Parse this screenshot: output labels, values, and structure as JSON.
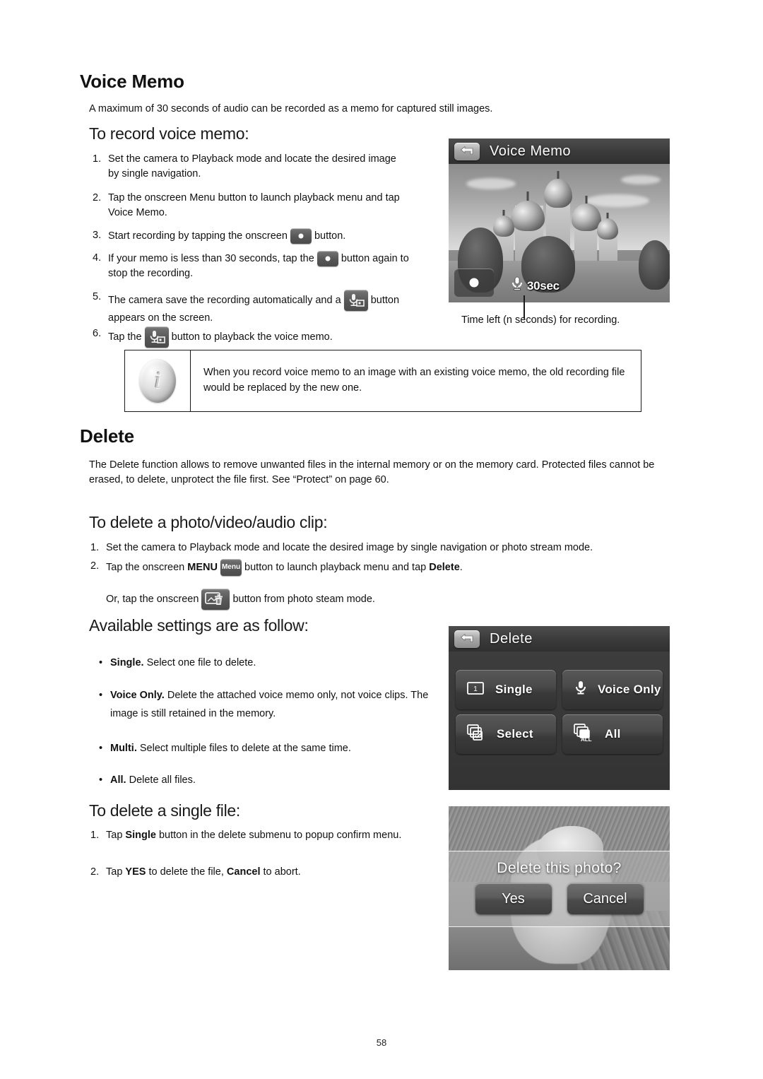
{
  "section_voice_memo": {
    "heading": "Voice Memo",
    "intro": "A maximum of 30 seconds of audio can be recorded as a memo for captured still images.",
    "subheading": "To record voice memo:",
    "steps": [
      {
        "n": "1.",
        "text": "Set the camera to Playback mode and locate the desired image by single navigation."
      },
      {
        "n": "2.",
        "text": "Tap the onscreen Menu button to launch playback menu and tap Voice Memo."
      },
      {
        "n": "3.",
        "pre": "Start recording by tapping the onscreen",
        "icon": "record-button-icon",
        "post": "button."
      },
      {
        "n": "4.",
        "pre": "If your memo is less than 30 seconds, tap the",
        "icon": "record-button-icon",
        "post": "button again to stop the recording."
      },
      {
        "n": "5.",
        "pre": "The camera save the recording automatically and a",
        "icon": "voice-memo-playback-icon",
        "post": "button appears on the screen."
      },
      {
        "n": "6.",
        "pre": "Tap the",
        "icon": "voice-memo-playback-icon",
        "post": "button to playback the voice memo."
      }
    ],
    "note": "When you record voice memo to an image with an existing voice memo, the old recording file would be replaced by the new one.",
    "caption": "Time left (n seconds) for recording."
  },
  "lcd_voice_memo": {
    "title": "Voice Memo",
    "back_icon": "back-arrow-icon",
    "record_icon": "record-dot-icon",
    "mic_icon": "microphone-icon",
    "time_left": "30sec"
  },
  "section_delete": {
    "heading": "Delete",
    "intro": "The Delete function allows to remove unwanted files in the internal memory or on the memory card. Protected files cannot be erased, to delete, unprotect the file first. See “Protect” on page 60.",
    "subheading_clip": "To delete a photo/video/audio clip:",
    "steps": [
      {
        "n": "1.",
        "text": "Set the camera to Playback mode and locate the desired image by single navigation or photo stream mode."
      }
    ],
    "step2_pre": "Tap the onscreen",
    "step2_menu_bold": "MENU",
    "step2_menu_icon_label": "Menu",
    "step2_post": "button to launch playback menu and tap",
    "step2_bold_end": "Delete",
    "step2_period": ".",
    "step2_or_pre": "Or, tap the onscreen",
    "step2_or_icon": "photo-trash-icon",
    "step2_or_post": "button from photo steam mode.",
    "subheading_settings": "Available settings are as follow:",
    "bullets": [
      {
        "bold": "Single.",
        "text": "Select one file to delete."
      },
      {
        "bold": "Voice Only.",
        "text": "Delete the attached voice memo only, not voice clips. The image is still retained in the memory."
      },
      {
        "bold": "Multi.",
        "text": "Select multiple files to delete at the same time."
      },
      {
        "bold": "All.",
        "text": "Delete all files."
      }
    ],
    "subheading_single": "To delete a single file:",
    "single_steps": [
      {
        "n": "1.",
        "pre": "Tap",
        "bold": "Single",
        "post": "button in the delete submenu to popup confirm menu."
      },
      {
        "n": "2.",
        "pre": "Tap",
        "bold": "YES",
        "mid": "to delete the file,",
        "bold2": "Cancel",
        "post": "to abort."
      }
    ]
  },
  "lcd_delete_menu": {
    "title": "Delete",
    "back_icon": "back-arrow-icon",
    "buttons": [
      {
        "label": "Single",
        "icon": "single-frame-icon"
      },
      {
        "label": "Voice Only",
        "icon": "microphone-icon"
      },
      {
        "label": "Select",
        "icon": "select-multi-check-icon"
      },
      {
        "label": "All",
        "icon": "all-stack-icon"
      }
    ]
  },
  "lcd_confirm": {
    "question": "Delete this photo?",
    "yes_label": "Yes",
    "cancel_label": "Cancel"
  },
  "footer": {
    "page_number": "58"
  },
  "colors": {
    "text": "#111111",
    "lcd_titlebar": "#3a3a3a",
    "lcd_button": "#4a4a4a",
    "note_border": "#1a1a1a"
  }
}
